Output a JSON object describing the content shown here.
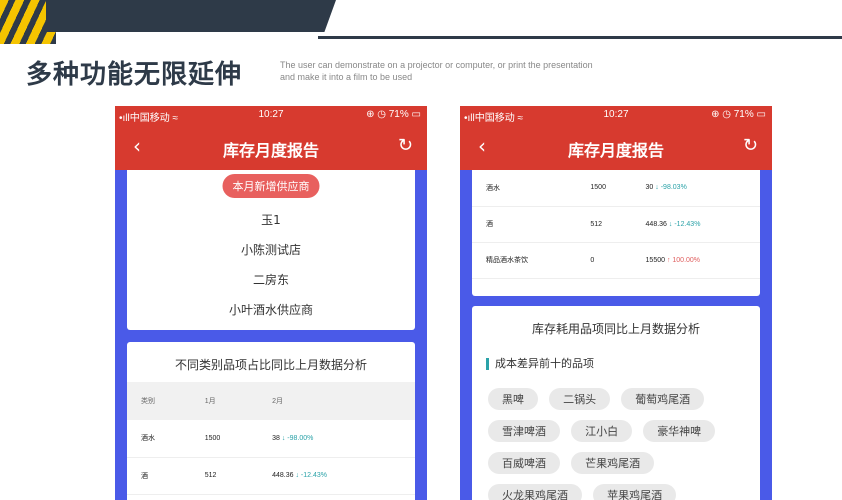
{
  "page": {
    "heading": "多种功能无限延伸",
    "subtitle_line1": "The user can demonstrate on a projector or computer, or print the presentation",
    "subtitle_line2": "and make it into a film to be used"
  },
  "status_bar": {
    "carrier": "中国移动",
    "time": "10:27",
    "battery": "71%"
  },
  "nav": {
    "title": "库存月度报告",
    "back_icon": "chevron-left-icon",
    "refresh_icon": "refresh-icon"
  },
  "left_phone": {
    "new_suppliers_label": "本月新增供应商",
    "suppliers": [
      "玉1",
      "小陈测试店",
      "二房东",
      "小叶酒水供应商"
    ],
    "compare_title": "不同类别品项占比同比上月数据分析",
    "headers": [
      "类别",
      "1月",
      "2月"
    ],
    "rows": [
      {
        "category": "酒水",
        "jan": "1500",
        "feb": "38",
        "change": "↓ -98.00%"
      },
      {
        "category": "酒",
        "jan": "512",
        "feb": "448.36",
        "change": "↓ -12.43%"
      }
    ]
  },
  "right_phone": {
    "rows": [
      {
        "category": "酒水",
        "jan": "1500",
        "feb": "30",
        "change": "↓ -98.03%"
      },
      {
        "category": "酒",
        "jan": "512",
        "feb": "448.36",
        "change": "↓ -12.43%"
      },
      {
        "category": "精品酒水茶饮",
        "jan": "0",
        "feb": "15500",
        "change": "↑ 100.00%"
      }
    ],
    "consumables_title": "库存耗用品项同比上月数据分析",
    "top10_label": "成本差异前十的品项",
    "tags": [
      "黑啤",
      "二锅头",
      "葡萄鸡尾酒",
      "雪津啤酒",
      "江小白",
      "豪华神啤",
      "百威啤酒",
      "芒果鸡尾酒",
      "火龙果鸡尾酒",
      "苹果鸡尾酒"
    ]
  },
  "colors": {
    "header_red": "#d73a2f",
    "phone_bg": "#4a5ae8",
    "accent": "#2e3a48",
    "down": "#2aa2a8",
    "up": "#e06060"
  }
}
